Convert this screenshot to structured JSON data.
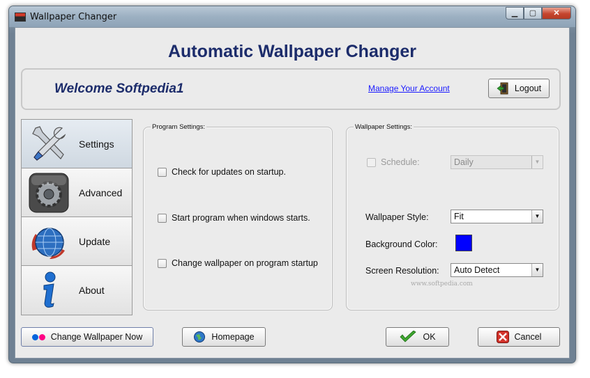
{
  "window": {
    "title": "Wallpaper Changer"
  },
  "header": {
    "app_title": "Automatic Wallpaper Changer"
  },
  "account": {
    "welcome": "Welcome Softpedia1",
    "manage_link": "Manage Your Account",
    "logout_label": "Logout"
  },
  "nav": {
    "items": [
      {
        "label": "Settings",
        "icon": "tools-icon",
        "active": true
      },
      {
        "label": "Advanced",
        "icon": "gear-icon",
        "active": false
      },
      {
        "label": "Update",
        "icon": "globe-icon",
        "active": false
      },
      {
        "label": "About",
        "icon": "info-icon",
        "active": false
      }
    ]
  },
  "program_settings": {
    "title": "Program Settings:",
    "options": [
      {
        "label": "Check for updates on startup.",
        "checked": false
      },
      {
        "label": "Start program when windows starts.",
        "checked": false
      },
      {
        "label": "Change wallpaper on program startup",
        "checked": false
      }
    ]
  },
  "wallpaper_settings": {
    "title": "Wallpaper Settings:",
    "schedule": {
      "label": "Schedule:",
      "checked": false,
      "enabled": false,
      "value": "Daily"
    },
    "style": {
      "label": "Wallpaper Style:",
      "value": "Fit"
    },
    "background": {
      "label": "Background Color:",
      "color": "#0000ff"
    },
    "resolution": {
      "label": "Screen Resolution:",
      "value": "Auto Detect"
    }
  },
  "watermark": "www.softpedia.com",
  "footer": {
    "change_now": "Change Wallpaper Now",
    "homepage": "Homepage",
    "ok": "OK",
    "cancel": "Cancel"
  },
  "colors": {
    "title_blue": "#1c2c6b",
    "link_blue": "#1a1aff",
    "flickr_blue": "#0063dc",
    "flickr_pink": "#ff0084",
    "ok_green": "#3ea62e",
    "cancel_red": "#d2322a"
  }
}
